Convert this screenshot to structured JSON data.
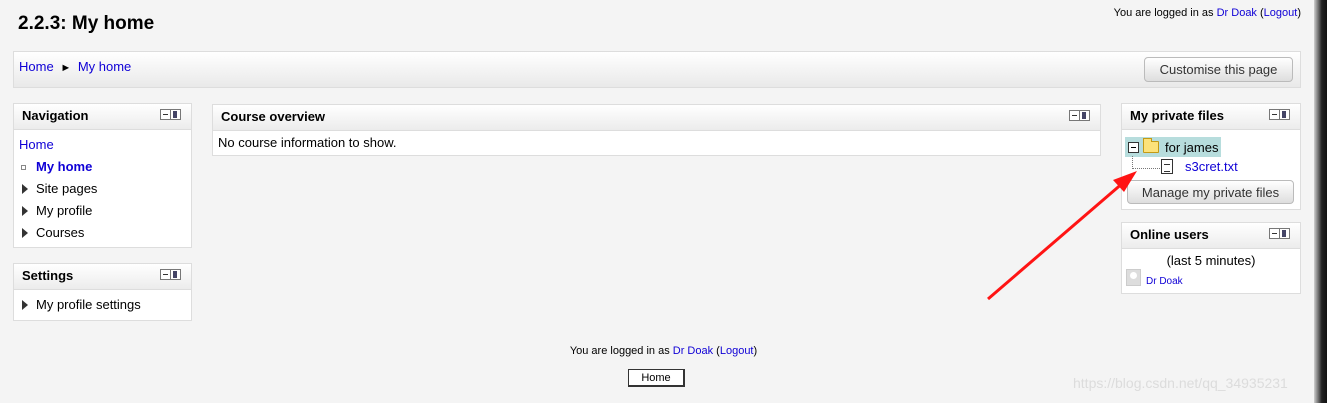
{
  "page": {
    "title": "2.2.3: My home",
    "login_prefix": "You are logged in as ",
    "user_name": "Dr Doak",
    "logout_open": "(",
    "logout_label": "Logout",
    "logout_close": ")"
  },
  "breadcrumb": {
    "home": "Home",
    "separator": "►",
    "current": "My home"
  },
  "navbar": {
    "customise_label": "Customise this page"
  },
  "navigation_block": {
    "title": "Navigation",
    "items": [
      {
        "label": "Home"
      },
      {
        "label": "My home"
      },
      {
        "label": "Site pages"
      },
      {
        "label": "My profile"
      },
      {
        "label": "Courses"
      }
    ]
  },
  "settings_block": {
    "title": "Settings",
    "items": [
      {
        "label": "My profile settings"
      }
    ]
  },
  "course_overview": {
    "title": "Course overview",
    "message": "No course information to show."
  },
  "private_files": {
    "title": "My private files",
    "folder": "for james",
    "file": "s3cret.txt",
    "manage_label": "Manage my private files"
  },
  "online_users": {
    "title": "Online users",
    "period": "(last 5 minutes)",
    "users": [
      "Dr Doak"
    ]
  },
  "footer": {
    "home_button": "Home"
  },
  "watermark": "https://blog.csdn.net/qq_34935231",
  "colors": {
    "link": "#0f00d6",
    "annotation_arrow": "#ff1414",
    "folder_highlight": "#b7dddd"
  }
}
